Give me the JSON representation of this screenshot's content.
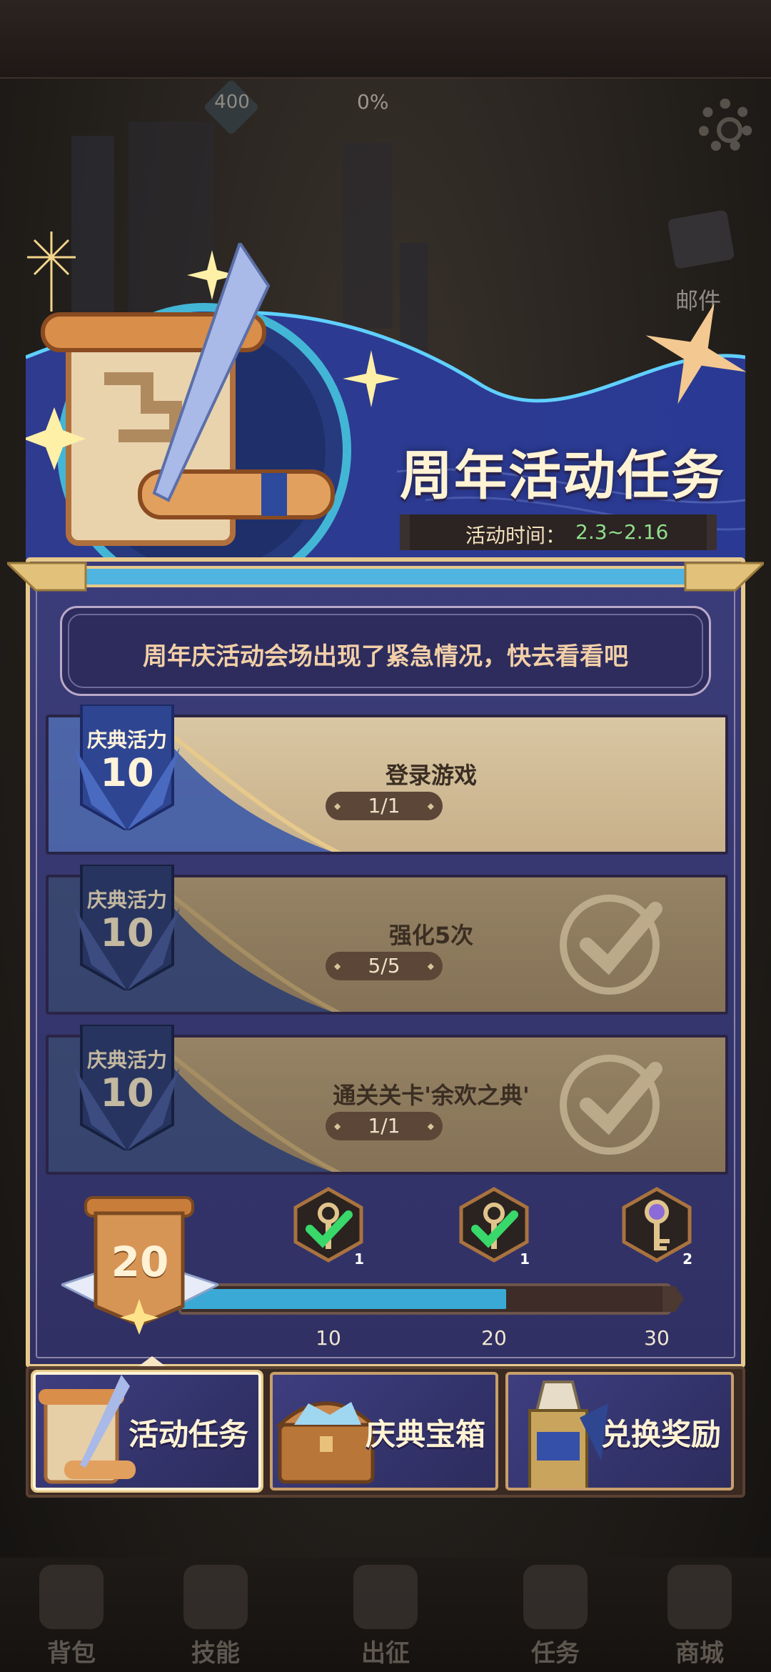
{
  "hud": {
    "gem_value": "400",
    "progress_percent": "0%",
    "mail_label": "邮件"
  },
  "event": {
    "title": "周年活动任务",
    "time_label": "活动时间：",
    "time_value": "2.3~2.16",
    "notice": "周年庆活动会场出现了紧急情况，快去看看吧"
  },
  "tasks": [
    {
      "badge_label": "庆典活力",
      "points": "10",
      "name": "登录游戏",
      "progress": "1/1",
      "claimed": false
    },
    {
      "badge_label": "庆典活力",
      "points": "10",
      "name": "强化5次",
      "progress": "5/5",
      "claimed": true
    },
    {
      "badge_label": "庆典活力",
      "points": "10",
      "name": "通关关卡'余欢之典'",
      "progress": "1/1",
      "claimed": true
    }
  ],
  "milestones": {
    "current": "20",
    "fill_ratio": 0.667,
    "rewards": [
      {
        "threshold": "10",
        "count": "1",
        "claimed": true,
        "icon": "key-icon"
      },
      {
        "threshold": "20",
        "count": "1",
        "claimed": true,
        "icon": "key-icon"
      },
      {
        "threshold": "30",
        "count": "2",
        "claimed": false,
        "icon": "key-icon"
      }
    ]
  },
  "tabs": [
    {
      "label": "活动任务",
      "active": true
    },
    {
      "label": "庆典宝箱",
      "active": false
    },
    {
      "label": "兑换奖励",
      "active": false
    }
  ],
  "bottom_nav": [
    {
      "label": "背包"
    },
    {
      "label": "技能"
    },
    {
      "label": "出征"
    },
    {
      "label": "任务"
    },
    {
      "label": "商城"
    }
  ],
  "colors": {
    "panel": "#34356e",
    "accent_gold": "#e6c98b",
    "progress_fill": "#3aa9d6",
    "time_value": "#8fe08a"
  }
}
